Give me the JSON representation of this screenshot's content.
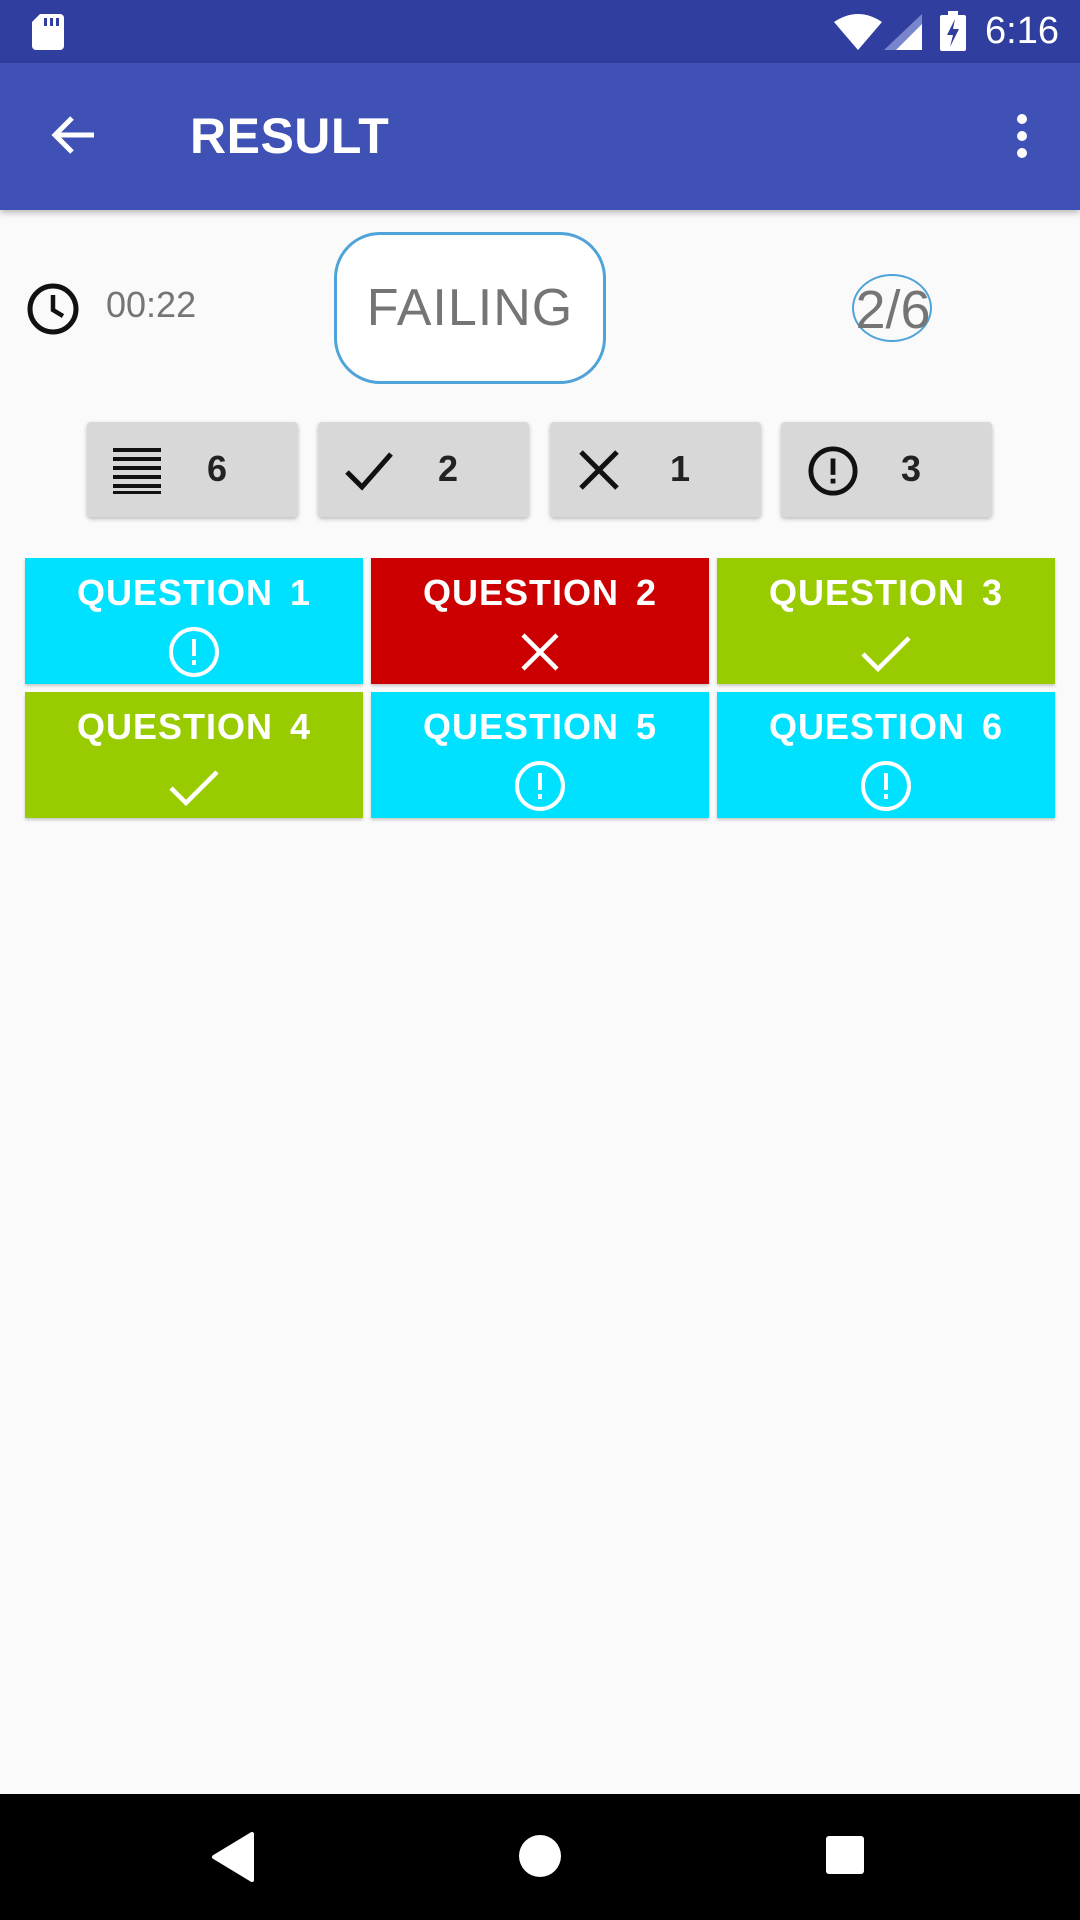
{
  "status_bar": {
    "time": "6:16"
  },
  "app_bar": {
    "title": "RESULT"
  },
  "summary": {
    "elapsed_time": "00:22",
    "status": "FAILING",
    "score": "2/6"
  },
  "stats": [
    {
      "icon": "list-icon",
      "value": "6"
    },
    {
      "icon": "check-icon",
      "value": "2"
    },
    {
      "icon": "close-icon",
      "value": "1"
    },
    {
      "icon": "alert-circle-icon",
      "value": "3"
    }
  ],
  "questions": [
    {
      "label": "QUESTION 1",
      "state": "unanswered",
      "icon": "alert-circle-icon",
      "color": "#00E0FF"
    },
    {
      "label": "QUESTION 2",
      "state": "wrong",
      "icon": "close-icon",
      "color": "#CC0000"
    },
    {
      "label": "QUESTION 3",
      "state": "correct",
      "icon": "check-icon",
      "color": "#99CC00"
    },
    {
      "label": "QUESTION 4",
      "state": "correct",
      "icon": "check-icon",
      "color": "#99CC00"
    },
    {
      "label": "QUESTION 5",
      "state": "unanswered",
      "icon": "alert-circle-icon",
      "color": "#00E0FF"
    },
    {
      "label": "QUESTION 6",
      "state": "unanswered",
      "icon": "alert-circle-icon",
      "color": "#00E0FF"
    }
  ],
  "colors": {
    "status_bar": "#303F9F",
    "app_bar": "#3F51B5",
    "accent_outline": "#4FA3D8"
  }
}
